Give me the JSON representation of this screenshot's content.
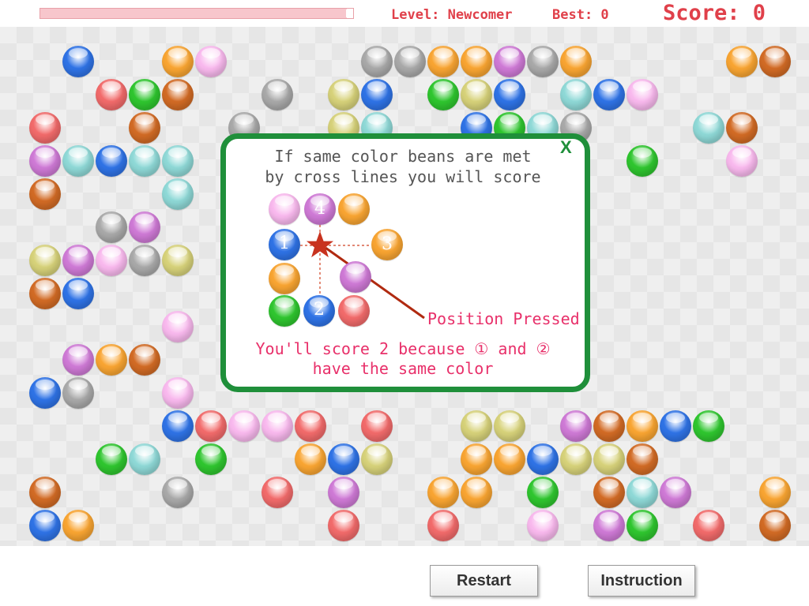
{
  "hud": {
    "level_label": "Level: Newcomer",
    "best_label": "Best: 0",
    "score_label": "Score: 0",
    "progress": 0.98
  },
  "colors": {
    "R": "#f26b6b",
    "O": "#f9a532",
    "P": "#f9b9ee",
    "B": "#2f73e6",
    "G": "#2fc62f",
    "Y": "#d7d27a",
    "C": "#8fd9d7",
    "A": "#a9a9a9",
    "M": "#cf7ad6",
    "K": "#d26b25"
  },
  "board_rows": [
    ".B..OP....AAOOMAO....OK.",
    "..RGK..A.YB.GYB.CBP....Y",
    "R..K..A..YC..BGCA...CK.Y.",
    "MCBCC.............G..P...",
    "K...C.....................",
    "..AM.......................",
    "YMPAY.......................",
    "KB......................",
    "....P...................",
    ".MOK.....................",
    "BA..P....................",
    "....BRPPR.R..YY.MKOBG...",
    "..GC.G..OBY..OOBYYK.....",
    "K...A..R.M..OO.G.KCM..OG",
    "BO.......R..R..P.MG.R.KR"
  ],
  "dialog": {
    "line1": "If same color beans are met",
    "line2": "by cross lines you will score",
    "close": "X",
    "pos_label": "Position Pressed",
    "explain1": "You'll score 2 because ① and ②",
    "explain2": "have the same color",
    "num1": "1",
    "num2": "2",
    "num3": "3",
    "num4": "4"
  },
  "buttons": {
    "restart": "Restart",
    "instruction": "Instruction"
  }
}
